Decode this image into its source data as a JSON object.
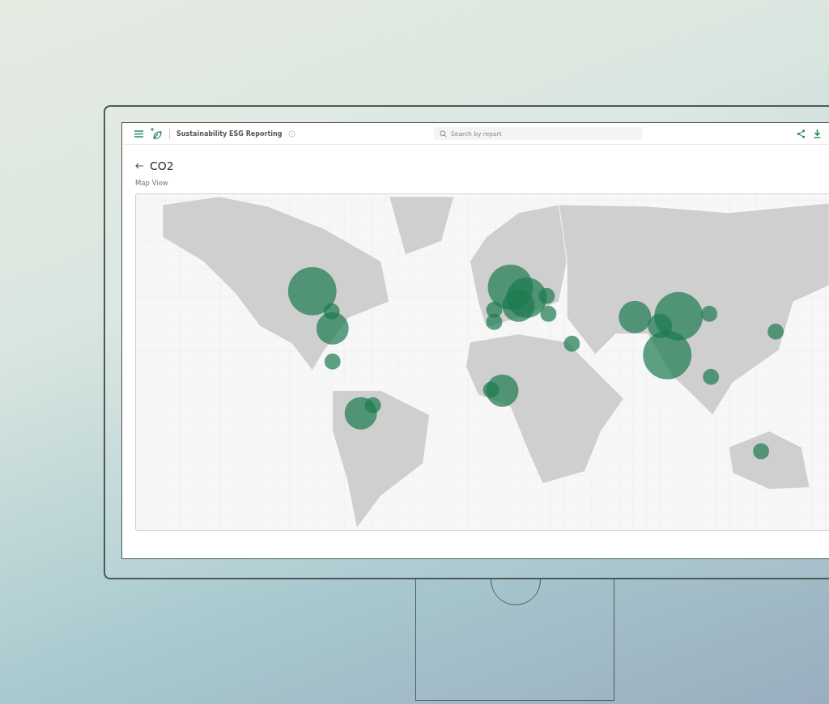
{
  "app_bar": {
    "title": "Sustainability ESG Reporting",
    "search": {
      "placeholder": "Search by report"
    }
  },
  "page": {
    "title": "CO2",
    "view_label": "Map View"
  }
}
